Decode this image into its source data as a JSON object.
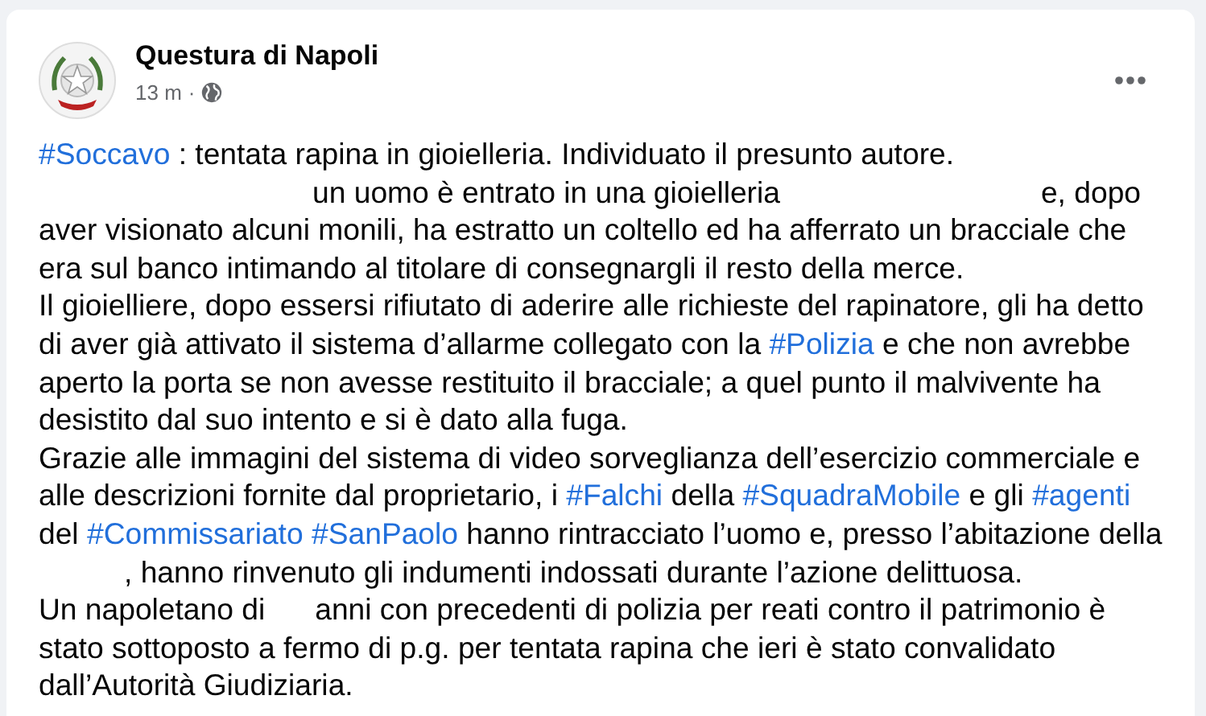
{
  "post": {
    "author": "Questura di Napoli",
    "time": "13 m",
    "separator": "·",
    "lines": [
      [
        {
          "kind": "tag",
          "text": "#Soccavo"
        },
        {
          "kind": "text",
          "text": " : tentata rapina in gioielleria. Individuato il presunto autore."
        }
      ],
      [
        {
          "kind": "gap"
        },
        {
          "kind": "text",
          "text": "un uomo è entrato in una gioielleria"
        },
        {
          "kind": "gap"
        },
        {
          "kind": "text",
          "text": "e, dopo"
        }
      ],
      [
        {
          "kind": "text",
          "text": "aver visionato alcuni monili, ha estratto un coltello ed ha afferrato un bracciale che"
        }
      ],
      [
        {
          "kind": "text",
          "text": "era sul banco intimando al titolare di consegnargli il resto della merce."
        }
      ],
      [
        {
          "kind": "text",
          "text": "Il gioielliere, dopo essersi rifiutato di aderire alle richieste del rapinatore, gli ha detto"
        }
      ],
      [
        {
          "kind": "text",
          "text": "di aver già attivato il sistema d’allarme collegato con la "
        },
        {
          "kind": "tag",
          "text": "#Polizia"
        },
        {
          "kind": "text",
          "text": " e che non avrebbe"
        }
      ],
      [
        {
          "kind": "text",
          "text": "aperto la porta se non avesse restituito il bracciale; a quel punto il malvivente ha"
        }
      ],
      [
        {
          "kind": "text",
          "text": "desistito dal suo intento e si è dato alla fuga."
        }
      ],
      [
        {
          "kind": "text",
          "text": "Grazie alle immagini del sistema di video sorveglianza dell’esercizio commerciale e"
        }
      ],
      [
        {
          "kind": "text",
          "text": "alle descrizioni fornite dal proprietario, i "
        },
        {
          "kind": "tag",
          "text": "#Falchi"
        },
        {
          "kind": "text",
          "text": " della "
        },
        {
          "kind": "tag",
          "text": "#SquadraMobile"
        },
        {
          "kind": "text",
          "text": " e gli "
        },
        {
          "kind": "tag",
          "text": "#agenti"
        }
      ],
      [
        {
          "kind": "text",
          "text": "del "
        },
        {
          "kind": "tag",
          "text": "#Commissariato"
        },
        {
          "kind": "space"
        },
        {
          "kind": "tag",
          "text": "#SanPaolo"
        },
        {
          "kind": "text",
          "text": " hanno rintracciato l’uomo e, presso l’abitazione della"
        }
      ],
      [
        {
          "kind": "gap"
        },
        {
          "kind": "text",
          "text": ", hanno rinvenuto gli indumenti indossati durante l’azione delittuosa."
        }
      ],
      [
        {
          "kind": "text",
          "text": "Un napoletano di"
        },
        {
          "kind": "gap"
        },
        {
          "kind": "text",
          "text": "anni con precedenti di polizia per reati contro il patrimonio è"
        }
      ],
      [
        {
          "kind": "text",
          "text": "stato sottoposto a fermo di p.g. per tentata rapina che ieri è stato convalidato"
        }
      ],
      [
        {
          "kind": "text",
          "text": "dall’Autorità Giudiziaria."
        }
      ]
    ]
  }
}
